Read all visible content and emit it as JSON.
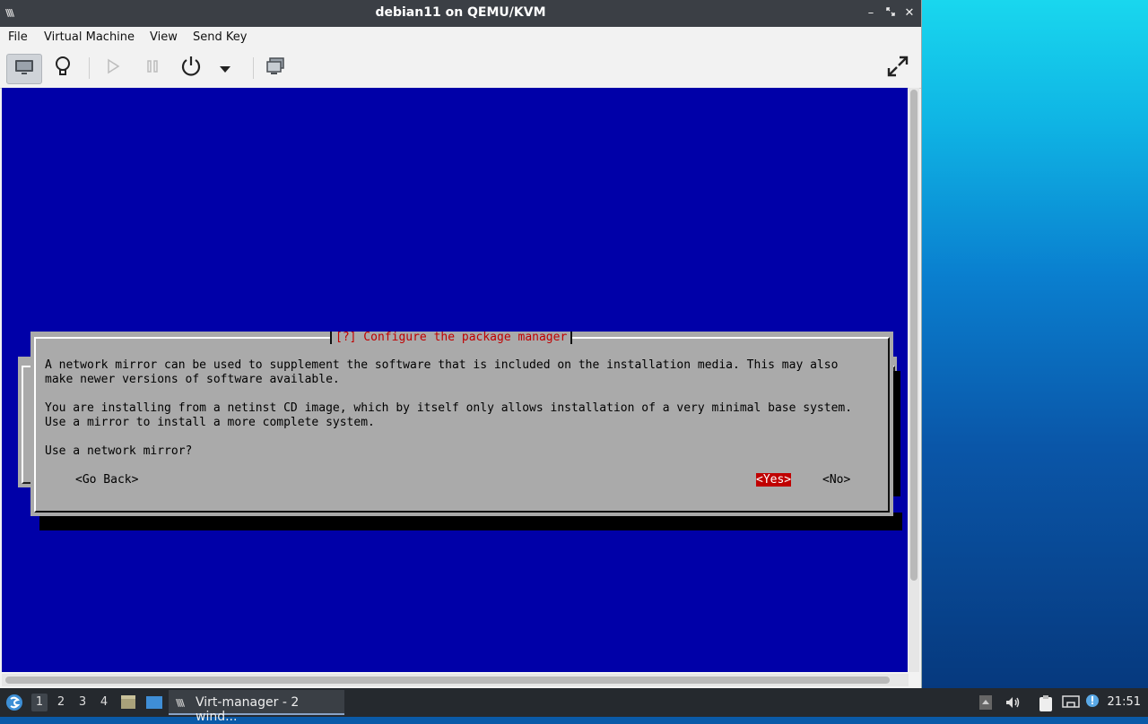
{
  "window": {
    "title": "debian11 on QEMU/KVM",
    "app_icon": "virt-manager-icon",
    "controls": [
      "minimize-icon",
      "maximize-icon",
      "close-icon"
    ]
  },
  "menubar": {
    "items": [
      "File",
      "Virtual Machine",
      "View",
      "Send Key"
    ]
  },
  "toolbar": {
    "buttons": [
      {
        "icon": "monitor-icon",
        "active": true
      },
      {
        "icon": "lightbulb-icon",
        "active": false
      },
      {
        "icon": "play-icon",
        "active": false
      },
      {
        "icon": "pause-icon",
        "active": false
      },
      {
        "icon": "power-icon",
        "active": false
      },
      {
        "icon": "chevron-down-icon",
        "active": false
      },
      {
        "icon": "screenshot-icon",
        "active": false
      },
      {
        "icon": "fullscreen-icon",
        "active": false
      }
    ]
  },
  "installer": {
    "dialog_title": "[?] Configure the package manager",
    "lines": [
      "A network mirror can be used to supplement the software that is included on the installation media. This may also",
      "make newer versions of software available.",
      "",
      "You are installing from a netinst CD image, which by itself only allows installation of a very minimal base system.",
      "Use a mirror to install a more complete system.",
      "",
      "Use a network mirror?"
    ],
    "buttons": {
      "go_back": "<Go Back>",
      "yes": "<Yes>",
      "no": "<No>"
    },
    "selected_button": "yes",
    "background_color": "#0000a8",
    "dialog_color": "#aaaaaa",
    "accent_color": "#c00000"
  },
  "taskbar": {
    "workspaces": [
      "1",
      "2",
      "3",
      "4"
    ],
    "current_workspace": "1",
    "task_label": "Virt-manager - 2 wind...",
    "clock": "21:51"
  }
}
